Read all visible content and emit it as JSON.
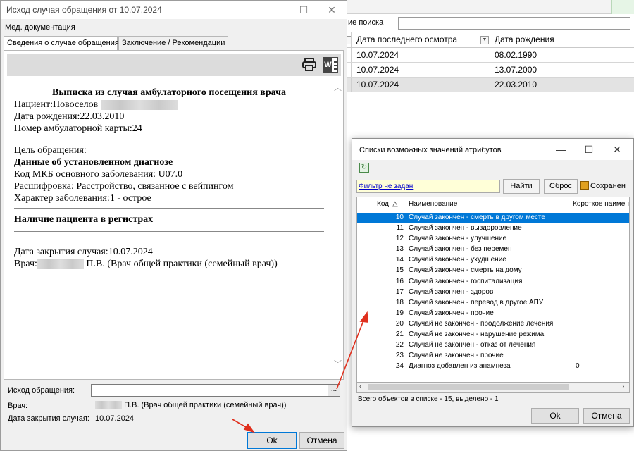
{
  "background_window": {
    "search_label": "ие поиска",
    "columns": [
      "Дата последнего осмотра",
      "Дата рождения"
    ],
    "rows": [
      [
        "10.07.2024",
        "08.02.1990"
      ],
      [
        "10.07.2024",
        "13.07.2000"
      ],
      [
        "10.07.2024",
        "22.03.2010"
      ]
    ]
  },
  "main_dialog": {
    "title": "Исход случая обращения от 10.07.2024",
    "window_controls": {
      "minimize": "—",
      "maximize": "☐",
      "close": "✕"
    },
    "menu": "Мед. документация",
    "tabs": [
      "Сведения о случае обращения",
      "Заключение / Рекомендации"
    ],
    "document": {
      "heading": "Выписка из случая амбулаторного посещения врача",
      "patient": "Пациент:Новоселов",
      "birth_date": "Дата рождения:22.03.2010",
      "card_number": "Номер амбулаторной карты:24",
      "purpose": "Цель обращения:",
      "diagnosis_heading": "Данные об установленном диагнозе",
      "mkb_code": "Код МКБ основного заболевания: U07.0",
      "decoding": "Расшифровка: Расстройство, связанное с вейпингом",
      "disease_character": "Характер заболевания:1 - острое",
      "registers_heading": "Наличие пациента в регистрах",
      "closing_date": "Дата закрытия случая:10.07.2024",
      "doctor_prefix": "Врач:",
      "doctor_suffix": "П.В. (Врач общей практики (семейный врач))"
    },
    "fields": {
      "exodus_label": "Исход обращения:",
      "exodus_value": "",
      "dots": "...",
      "doctor_label": "Врач:",
      "doctor_value": "П.В. (Врач общей практики (семейный врач))",
      "closing_label": "Дата закрытия случая:",
      "closing_value": "10.07.2024"
    },
    "buttons": {
      "ok": "Ok",
      "cancel": "Отмена"
    }
  },
  "lists_dialog": {
    "title": "Списки возможных значений атрибутов",
    "window_controls": {
      "minimize": "—",
      "maximize": "☐",
      "close": "✕"
    },
    "filter_link": "Фильтр не задан",
    "buttons": {
      "find": "Найти",
      "reset": "Сброс",
      "save": "Сохранен",
      "ok": "Ok",
      "cancel": "Отмена"
    },
    "columns": {
      "code": "Код",
      "name": "Наименование",
      "short": "Короткое наимено"
    },
    "rows": [
      {
        "code": "10",
        "name": "Случай закончен - смерть в другом месте",
        "short": ""
      },
      {
        "code": "11",
        "name": "Случай закончен - выздоровление",
        "short": ""
      },
      {
        "code": "12",
        "name": "Случай закончен - улучшение",
        "short": ""
      },
      {
        "code": "13",
        "name": "Случай закончен - без перемен",
        "short": ""
      },
      {
        "code": "14",
        "name": "Случай закончен - ухудшение",
        "short": ""
      },
      {
        "code": "15",
        "name": "Случай закончен - смерть на дому",
        "short": ""
      },
      {
        "code": "16",
        "name": "Случай закончен - госпитализация",
        "short": ""
      },
      {
        "code": "17",
        "name": "Случай закончен - здоров",
        "short": ""
      },
      {
        "code": "18",
        "name": "Случай закончен - перевод в другое АПУ",
        "short": ""
      },
      {
        "code": "19",
        "name": "Случай закончен - прочие",
        "short": ""
      },
      {
        "code": "20",
        "name": "Случай не закончен - продолжение лечения",
        "short": ""
      },
      {
        "code": "21",
        "name": "Случай не закончен - нарушение режима",
        "short": ""
      },
      {
        "code": "22",
        "name": "Случай не закончен - отказ от лечения",
        "short": ""
      },
      {
        "code": "23",
        "name": "Случай не закончен - прочие",
        "short": ""
      },
      {
        "code": "24",
        "name": "Диагноз добавлен из анамнеза",
        "short": "0"
      }
    ],
    "status": "Всего объектов в списке - 15, выделено - 1"
  }
}
